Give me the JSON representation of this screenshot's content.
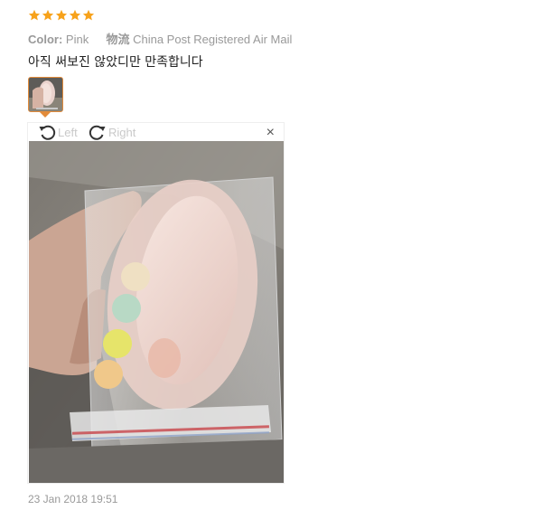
{
  "review": {
    "rating": 5,
    "star_color": "#f7a21b",
    "color_label": "Color:",
    "color_value": "Pink",
    "shipping_label": "物流",
    "shipping_value": "China Post Registered Air Mail",
    "comment": "아직 써보진 않았디만 만족합니다",
    "date": "23 Jan 2018 19:51"
  },
  "viewer": {
    "rotate_left_label": "Left",
    "rotate_right_label": "Right",
    "close_glyph": "×",
    "accent_color": "#e28b3a"
  },
  "icons": {
    "star": "star-icon",
    "rotate_left": "rotate-left-icon",
    "rotate_right": "rotate-right-icon",
    "close": "close-icon"
  }
}
